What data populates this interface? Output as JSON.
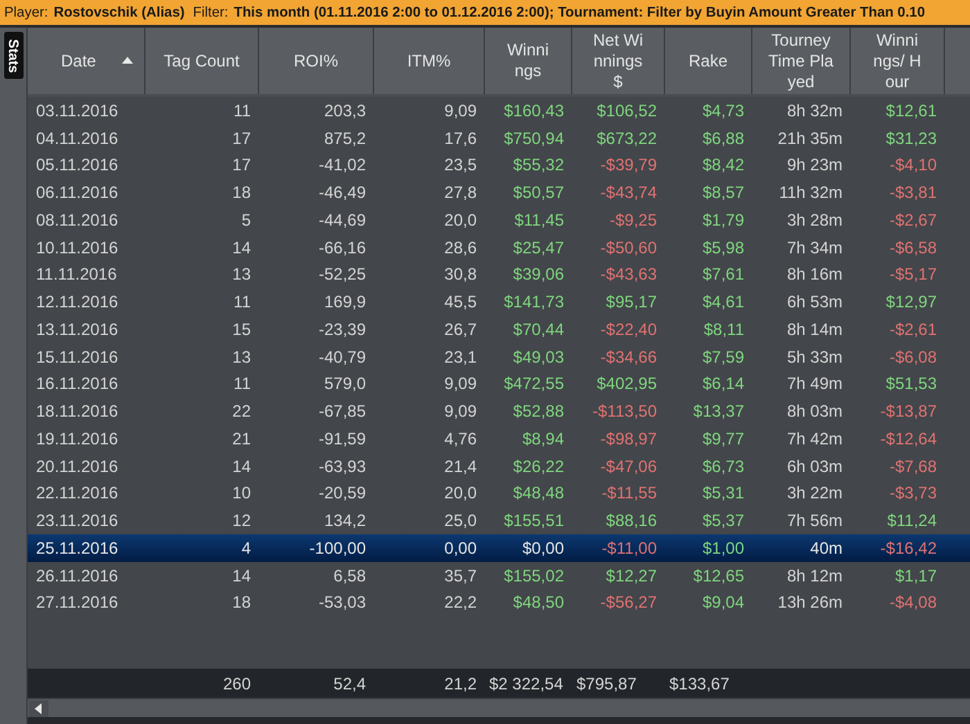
{
  "filter_bar": [
    {
      "label": "Player:",
      "value": "Rostovschik (Alias)"
    },
    {
      "label": "Filter:",
      "value": "This month (01.11.2016 2:00 to 01.12.2016 2:00); Tournament: Filter by Buyin Amount Greater Than 0.10"
    }
  ],
  "side_tab": {
    "label": "Stats"
  },
  "table": {
    "columns": [
      {
        "label": "Date",
        "sorted": true
      },
      {
        "label": "Tag Count",
        "sorted": false
      },
      {
        "label": "ROI%",
        "sorted": false
      },
      {
        "label": "ITM%",
        "sorted": false
      },
      {
        "label": "Winnings",
        "sorted": false
      },
      {
        "label": "Net Winnings $",
        "sorted": false
      },
      {
        "label": "Rake",
        "sorted": false
      },
      {
        "label": "Tourney Time Played",
        "sorted": false
      },
      {
        "label": "Winnings/ Hour",
        "sorted": false
      }
    ],
    "rows": [
      {
        "selected": false,
        "cells": [
          {
            "text": "03.11.2016",
            "color": "#d4d4d4"
          },
          {
            "text": "11",
            "color": "#d4d4d4"
          },
          {
            "text": "203,3",
            "color": "#d4d4d4"
          },
          {
            "text": "9,09",
            "color": "#d4d4d4"
          },
          {
            "text": "$160,43",
            "color": "#7fd67f"
          },
          {
            "text": "$106,52",
            "color": "#7fd67f"
          },
          {
            "text": "$4,73",
            "color": "#7fd67f"
          },
          {
            "text": "8h 32m",
            "color": "#d4d4d4"
          },
          {
            "text": "$12,61",
            "color": "#7fd67f"
          }
        ]
      },
      {
        "selected": false,
        "cells": [
          {
            "text": "04.11.2016",
            "color": "#d4d4d4"
          },
          {
            "text": "17",
            "color": "#d4d4d4"
          },
          {
            "text": "875,2",
            "color": "#d4d4d4"
          },
          {
            "text": "17,6",
            "color": "#d4d4d4"
          },
          {
            "text": "$750,94",
            "color": "#7fd67f"
          },
          {
            "text": "$673,22",
            "color": "#7fd67f"
          },
          {
            "text": "$6,88",
            "color": "#7fd67f"
          },
          {
            "text": "21h 35m",
            "color": "#d4d4d4"
          },
          {
            "text": "$31,23",
            "color": "#7fd67f"
          }
        ]
      },
      {
        "selected": false,
        "cells": [
          {
            "text": "05.11.2016",
            "color": "#d4d4d4"
          },
          {
            "text": "17",
            "color": "#d4d4d4"
          },
          {
            "text": "-41,02",
            "color": "#d4d4d4"
          },
          {
            "text": "23,5",
            "color": "#d4d4d4"
          },
          {
            "text": "$55,32",
            "color": "#7fd67f"
          },
          {
            "text": "-$39,79",
            "color": "#e07272"
          },
          {
            "text": "$8,42",
            "color": "#7fd67f"
          },
          {
            "text": "9h 23m",
            "color": "#d4d4d4"
          },
          {
            "text": "-$4,10",
            "color": "#e07272"
          }
        ]
      },
      {
        "selected": false,
        "cells": [
          {
            "text": "06.11.2016",
            "color": "#d4d4d4"
          },
          {
            "text": "18",
            "color": "#d4d4d4"
          },
          {
            "text": "-46,49",
            "color": "#d4d4d4"
          },
          {
            "text": "27,8",
            "color": "#d4d4d4"
          },
          {
            "text": "$50,57",
            "color": "#7fd67f"
          },
          {
            "text": "-$43,74",
            "color": "#e07272"
          },
          {
            "text": "$8,57",
            "color": "#7fd67f"
          },
          {
            "text": "11h 32m",
            "color": "#d4d4d4"
          },
          {
            "text": "-$3,81",
            "color": "#e07272"
          }
        ]
      },
      {
        "selected": false,
        "cells": [
          {
            "text": "08.11.2016",
            "color": "#d4d4d4"
          },
          {
            "text": "5",
            "color": "#d4d4d4"
          },
          {
            "text": "-44,69",
            "color": "#d4d4d4"
          },
          {
            "text": "20,0",
            "color": "#d4d4d4"
          },
          {
            "text": "$11,45",
            "color": "#7fd67f"
          },
          {
            "text": "-$9,25",
            "color": "#e07272"
          },
          {
            "text": "$1,79",
            "color": "#7fd67f"
          },
          {
            "text": "3h 28m",
            "color": "#d4d4d4"
          },
          {
            "text": "-$2,67",
            "color": "#e07272"
          }
        ]
      },
      {
        "selected": false,
        "cells": [
          {
            "text": "10.11.2016",
            "color": "#d4d4d4"
          },
          {
            "text": "14",
            "color": "#d4d4d4"
          },
          {
            "text": "-66,16",
            "color": "#d4d4d4"
          },
          {
            "text": "28,6",
            "color": "#d4d4d4"
          },
          {
            "text": "$25,47",
            "color": "#7fd67f"
          },
          {
            "text": "-$50,60",
            "color": "#e07272"
          },
          {
            "text": "$5,98",
            "color": "#7fd67f"
          },
          {
            "text": "7h 34m",
            "color": "#d4d4d4"
          },
          {
            "text": "-$6,58",
            "color": "#e07272"
          }
        ]
      },
      {
        "selected": false,
        "cells": [
          {
            "text": "11.11.2016",
            "color": "#d4d4d4"
          },
          {
            "text": "13",
            "color": "#d4d4d4"
          },
          {
            "text": "-52,25",
            "color": "#d4d4d4"
          },
          {
            "text": "30,8",
            "color": "#d4d4d4"
          },
          {
            "text": "$39,06",
            "color": "#7fd67f"
          },
          {
            "text": "-$43,63",
            "color": "#e07272"
          },
          {
            "text": "$7,61",
            "color": "#7fd67f"
          },
          {
            "text": "8h 16m",
            "color": "#d4d4d4"
          },
          {
            "text": "-$5,17",
            "color": "#e07272"
          }
        ]
      },
      {
        "selected": false,
        "cells": [
          {
            "text": "12.11.2016",
            "color": "#d4d4d4"
          },
          {
            "text": "11",
            "color": "#d4d4d4"
          },
          {
            "text": "169,9",
            "color": "#d4d4d4"
          },
          {
            "text": "45,5",
            "color": "#d4d4d4"
          },
          {
            "text": "$141,73",
            "color": "#7fd67f"
          },
          {
            "text": "$95,17",
            "color": "#7fd67f"
          },
          {
            "text": "$4,61",
            "color": "#7fd67f"
          },
          {
            "text": "6h 53m",
            "color": "#d4d4d4"
          },
          {
            "text": "$12,97",
            "color": "#7fd67f"
          }
        ]
      },
      {
        "selected": false,
        "cells": [
          {
            "text": "13.11.2016",
            "color": "#d4d4d4"
          },
          {
            "text": "15",
            "color": "#d4d4d4"
          },
          {
            "text": "-23,39",
            "color": "#d4d4d4"
          },
          {
            "text": "26,7",
            "color": "#d4d4d4"
          },
          {
            "text": "$70,44",
            "color": "#7fd67f"
          },
          {
            "text": "-$22,40",
            "color": "#e07272"
          },
          {
            "text": "$8,11",
            "color": "#7fd67f"
          },
          {
            "text": "8h 14m",
            "color": "#d4d4d4"
          },
          {
            "text": "-$2,61",
            "color": "#e07272"
          }
        ]
      },
      {
        "selected": false,
        "cells": [
          {
            "text": "15.11.2016",
            "color": "#d4d4d4"
          },
          {
            "text": "13",
            "color": "#d4d4d4"
          },
          {
            "text": "-40,79",
            "color": "#d4d4d4"
          },
          {
            "text": "23,1",
            "color": "#d4d4d4"
          },
          {
            "text": "$49,03",
            "color": "#7fd67f"
          },
          {
            "text": "-$34,66",
            "color": "#e07272"
          },
          {
            "text": "$7,59",
            "color": "#7fd67f"
          },
          {
            "text": "5h 33m",
            "color": "#d4d4d4"
          },
          {
            "text": "-$6,08",
            "color": "#e07272"
          }
        ]
      },
      {
        "selected": false,
        "cells": [
          {
            "text": "16.11.2016",
            "color": "#d4d4d4"
          },
          {
            "text": "11",
            "color": "#d4d4d4"
          },
          {
            "text": "579,0",
            "color": "#d4d4d4"
          },
          {
            "text": "9,09",
            "color": "#d4d4d4"
          },
          {
            "text": "$472,55",
            "color": "#7fd67f"
          },
          {
            "text": "$402,95",
            "color": "#7fd67f"
          },
          {
            "text": "$6,14",
            "color": "#7fd67f"
          },
          {
            "text": "7h 49m",
            "color": "#d4d4d4"
          },
          {
            "text": "$51,53",
            "color": "#7fd67f"
          }
        ]
      },
      {
        "selected": false,
        "cells": [
          {
            "text": "18.11.2016",
            "color": "#d4d4d4"
          },
          {
            "text": "22",
            "color": "#d4d4d4"
          },
          {
            "text": "-67,85",
            "color": "#d4d4d4"
          },
          {
            "text": "9,09",
            "color": "#d4d4d4"
          },
          {
            "text": "$52,88",
            "color": "#7fd67f"
          },
          {
            "text": "-$113,50",
            "color": "#e07272"
          },
          {
            "text": "$13,37",
            "color": "#7fd67f"
          },
          {
            "text": "8h 03m",
            "color": "#d4d4d4"
          },
          {
            "text": "-$13,87",
            "color": "#e07272"
          }
        ]
      },
      {
        "selected": false,
        "cells": [
          {
            "text": "19.11.2016",
            "color": "#d4d4d4"
          },
          {
            "text": "21",
            "color": "#d4d4d4"
          },
          {
            "text": "-91,59",
            "color": "#d4d4d4"
          },
          {
            "text": "4,76",
            "color": "#d4d4d4"
          },
          {
            "text": "$8,94",
            "color": "#7fd67f"
          },
          {
            "text": "-$98,97",
            "color": "#e07272"
          },
          {
            "text": "$9,77",
            "color": "#7fd67f"
          },
          {
            "text": "7h 42m",
            "color": "#d4d4d4"
          },
          {
            "text": "-$12,64",
            "color": "#e07272"
          }
        ]
      },
      {
        "selected": false,
        "cells": [
          {
            "text": "20.11.2016",
            "color": "#d4d4d4"
          },
          {
            "text": "14",
            "color": "#d4d4d4"
          },
          {
            "text": "-63,93",
            "color": "#d4d4d4"
          },
          {
            "text": "21,4",
            "color": "#d4d4d4"
          },
          {
            "text": "$26,22",
            "color": "#7fd67f"
          },
          {
            "text": "-$47,06",
            "color": "#e07272"
          },
          {
            "text": "$6,73",
            "color": "#7fd67f"
          },
          {
            "text": "6h 03m",
            "color": "#d4d4d4"
          },
          {
            "text": "-$7,68",
            "color": "#e07272"
          }
        ]
      },
      {
        "selected": false,
        "cells": [
          {
            "text": "22.11.2016",
            "color": "#d4d4d4"
          },
          {
            "text": "10",
            "color": "#d4d4d4"
          },
          {
            "text": "-20,59",
            "color": "#d4d4d4"
          },
          {
            "text": "20,0",
            "color": "#d4d4d4"
          },
          {
            "text": "$48,48",
            "color": "#7fd67f"
          },
          {
            "text": "-$11,55",
            "color": "#e07272"
          },
          {
            "text": "$5,31",
            "color": "#7fd67f"
          },
          {
            "text": "3h 22m",
            "color": "#d4d4d4"
          },
          {
            "text": "-$3,73",
            "color": "#e07272"
          }
        ]
      },
      {
        "selected": false,
        "cells": [
          {
            "text": "23.11.2016",
            "color": "#d4d4d4"
          },
          {
            "text": "12",
            "color": "#d4d4d4"
          },
          {
            "text": "134,2",
            "color": "#d4d4d4"
          },
          {
            "text": "25,0",
            "color": "#d4d4d4"
          },
          {
            "text": "$155,51",
            "color": "#7fd67f"
          },
          {
            "text": "$88,16",
            "color": "#7fd67f"
          },
          {
            "text": "$5,37",
            "color": "#7fd67f"
          },
          {
            "text": "7h 56m",
            "color": "#d4d4d4"
          },
          {
            "text": "$11,24",
            "color": "#7fd67f"
          }
        ]
      },
      {
        "selected": true,
        "cells": [
          {
            "text": "25.11.2016",
            "color": "#e6e6e6"
          },
          {
            "text": "4",
            "color": "#e6e6e6"
          },
          {
            "text": "-100,00",
            "color": "#e6e6e6"
          },
          {
            "text": "0,00",
            "color": "#e6e6e6"
          },
          {
            "text": "$0,00",
            "color": "#e6e6e6"
          },
          {
            "text": "-$11,00",
            "color": "#e07272"
          },
          {
            "text": "$1,00",
            "color": "#7fd67f"
          },
          {
            "text": "40m",
            "color": "#e6e6e6"
          },
          {
            "text": "-$16,42",
            "color": "#e07272"
          }
        ]
      },
      {
        "selected": false,
        "cells": [
          {
            "text": "26.11.2016",
            "color": "#d4d4d4"
          },
          {
            "text": "14",
            "color": "#d4d4d4"
          },
          {
            "text": "6,58",
            "color": "#d4d4d4"
          },
          {
            "text": "35,7",
            "color": "#d4d4d4"
          },
          {
            "text": "$155,02",
            "color": "#7fd67f"
          },
          {
            "text": "$12,27",
            "color": "#7fd67f"
          },
          {
            "text": "$12,65",
            "color": "#7fd67f"
          },
          {
            "text": "8h 12m",
            "color": "#d4d4d4"
          },
          {
            "text": "$1,17",
            "color": "#7fd67f"
          }
        ]
      },
      {
        "selected": false,
        "cells": [
          {
            "text": "27.11.2016",
            "color": "#d4d4d4"
          },
          {
            "text": "18",
            "color": "#d4d4d4"
          },
          {
            "text": "-53,03",
            "color": "#d4d4d4"
          },
          {
            "text": "22,2",
            "color": "#d4d4d4"
          },
          {
            "text": "$48,50",
            "color": "#7fd67f"
          },
          {
            "text": "-$56,27",
            "color": "#e07272"
          },
          {
            "text": "$9,04",
            "color": "#7fd67f"
          },
          {
            "text": "13h 26m",
            "color": "#d4d4d4"
          },
          {
            "text": "-$4,08",
            "color": "#e07272"
          }
        ]
      }
    ],
    "totals": [
      "260",
      "52,4",
      "21,2",
      "$2 322,54",
      "$795,87",
      "$133,67"
    ]
  }
}
